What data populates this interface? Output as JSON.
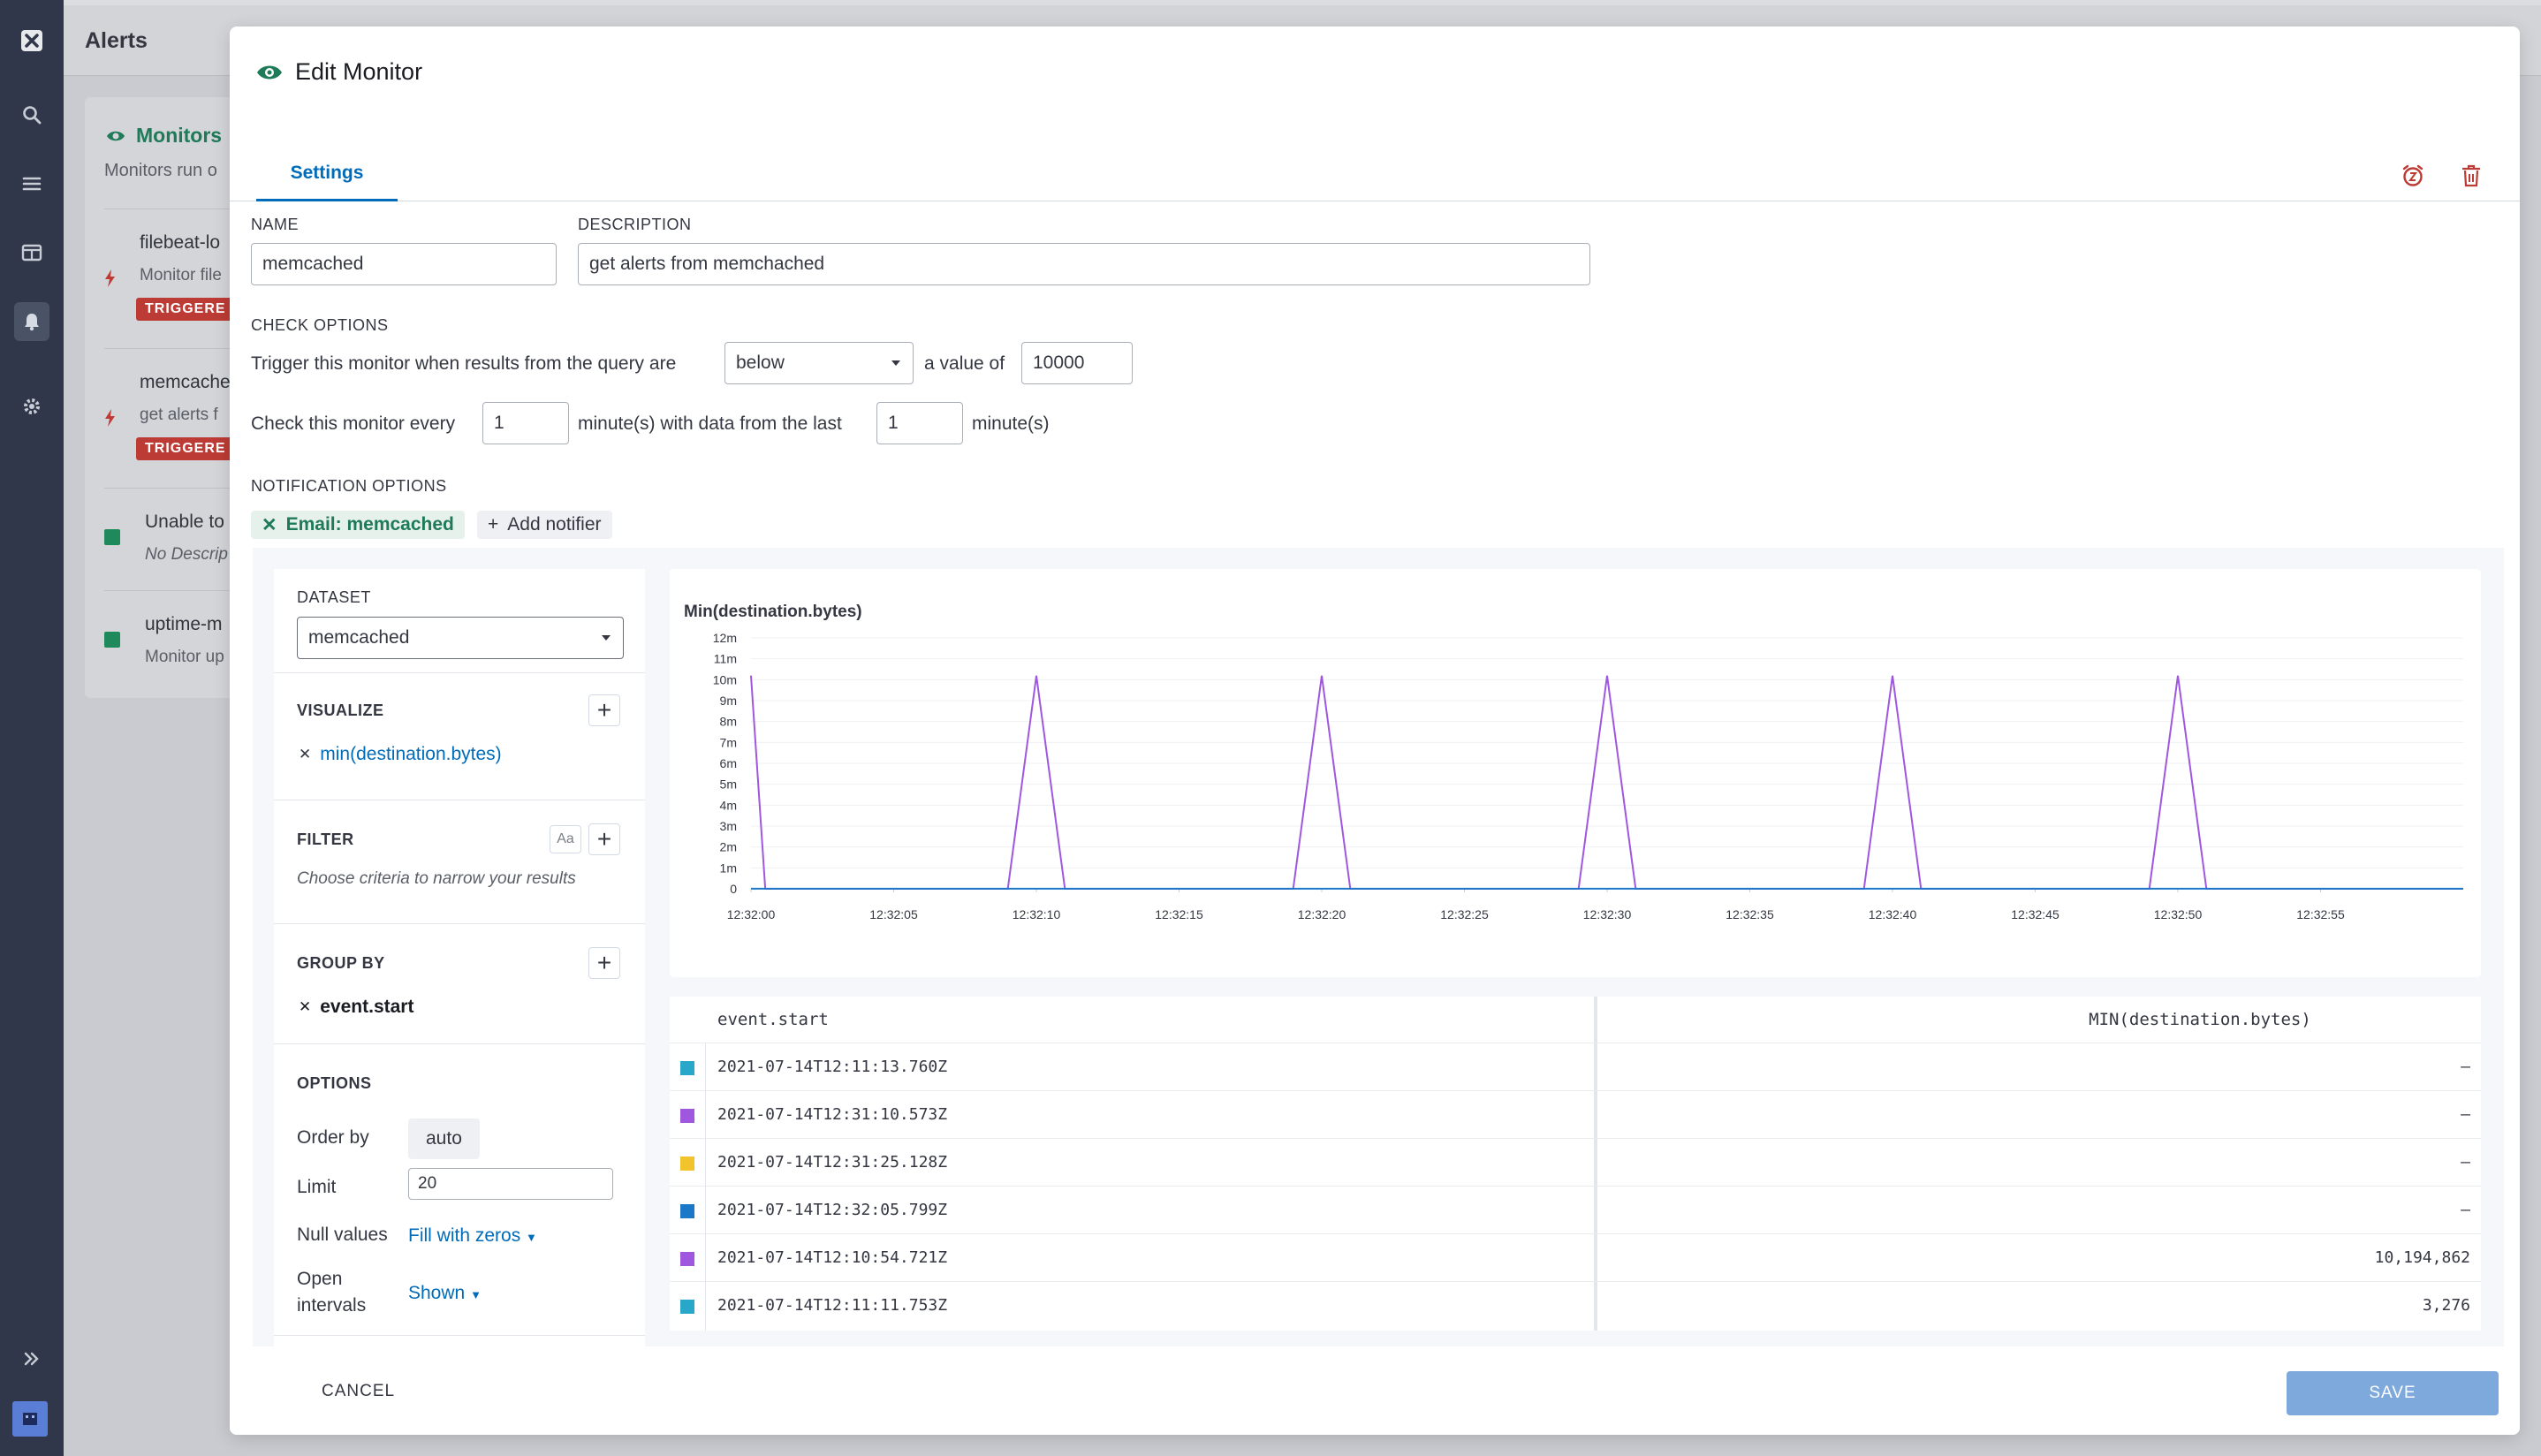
{
  "app": {
    "page_title": "Alerts"
  },
  "background": {
    "monitors_title": "Monitors",
    "monitors_sub": "Monitors run o",
    "items": [
      {
        "title": "filebeat-lo",
        "sub": "Monitor file",
        "badge": "TRIGGERE"
      },
      {
        "title": "memcache",
        "sub": "get alerts f",
        "badge": "TRIGGERE"
      },
      {
        "title": "Unable to",
        "sub": "No Descrip"
      },
      {
        "title": "uptime-m",
        "sub": "Monitor up"
      }
    ]
  },
  "modal": {
    "title": "Edit Monitor",
    "tab_settings": "Settings",
    "name_label": "NAME",
    "name_value": "memcached",
    "description_label": "DESCRIPTION",
    "description_value": "get alerts from memchached",
    "check_options_label": "CHECK OPTIONS",
    "trigger_text": "Trigger this monitor when results from the query are",
    "trigger_op": "below",
    "value_text": "a value of",
    "trigger_value": "10000",
    "check_every_text": "Check this monitor every",
    "check_every_value": "1",
    "minutes_data_text": "minute(s) with data from the last",
    "last_value": "1",
    "minutes_text": "minute(s)",
    "notification_label": "NOTIFICATION OPTIONS",
    "notifier": "Email: memcached",
    "add_notifier": "Add notifier",
    "cancel": "CANCEL",
    "save": "SAVE"
  },
  "query": {
    "dataset_label": "DATASET",
    "dataset_value": "memcached",
    "visualize_label": "VISUALIZE",
    "visualize_item": "min(destination.bytes)",
    "filter_label": "FILTER",
    "filter_aa": "Aa",
    "filter_hint": "Choose criteria to narrow your results",
    "groupby_label": "GROUP BY",
    "groupby_item": "event.start",
    "options_label": "OPTIONS",
    "order_by_label": "Order by",
    "order_by_value": "auto",
    "limit_label": "Limit",
    "limit_value": "20",
    "null_label": "Null values",
    "null_value": "Fill with zeros",
    "open_label_1": "Open",
    "open_label_2": "intervals",
    "open_value": "Shown"
  },
  "chart_data": {
    "type": "line",
    "title": "Min(destination.bytes)",
    "xlabel": "",
    "ylabel": "",
    "ylim": [
      0,
      12000000
    ],
    "yticks": [
      "0",
      "1m",
      "2m",
      "3m",
      "4m",
      "5m",
      "6m",
      "7m",
      "8m",
      "9m",
      "10m",
      "11m",
      "12m"
    ],
    "xticks": [
      "12:32:00",
      "12:32:05",
      "12:32:10",
      "12:32:15",
      "12:32:20",
      "12:32:25",
      "12:32:30",
      "12:32:35",
      "12:32:40",
      "12:32:45",
      "12:32:50",
      "12:32:55"
    ],
    "xlim_seconds": [
      0,
      60
    ],
    "grid": true,
    "series": [
      {
        "color": "#9f57e0",
        "x": [
          0,
          0.5,
          9,
          10,
          11,
          19,
          20,
          21,
          29,
          30,
          31,
          39,
          40,
          41,
          49,
          50,
          51,
          60
        ],
        "values": [
          10194862,
          0,
          0,
          10194862,
          0,
          0,
          10194862,
          0,
          0,
          10194862,
          0,
          0,
          10194862,
          0,
          0,
          10194862,
          0,
          0
        ]
      },
      {
        "color": "#1b78c9",
        "x": [
          0,
          10,
          20,
          30,
          40,
          50,
          60
        ],
        "values": [
          3276,
          3276,
          3276,
          3276,
          3276,
          3276,
          3276
        ]
      }
    ]
  },
  "table": {
    "col1": "event.start",
    "col2": "MIN(destination.bytes)",
    "rows": [
      {
        "color": "#28a7c9",
        "start": "2021-07-14T12:11:13.760Z",
        "value": "–"
      },
      {
        "color": "#9f57e0",
        "start": "2021-07-14T12:31:10.573Z",
        "value": "–"
      },
      {
        "color": "#f1c42d",
        "start": "2021-07-14T12:31:25.128Z",
        "value": "–"
      },
      {
        "color": "#1b78c9",
        "start": "2021-07-14T12:32:05.799Z",
        "value": "–"
      },
      {
        "color": "#9f57e0",
        "start": "2021-07-14T12:10:54.721Z",
        "value": "10,194,862"
      },
      {
        "color": "#28a7c9",
        "start": "2021-07-14T12:11:11.753Z",
        "value": "3,276"
      }
    ]
  }
}
